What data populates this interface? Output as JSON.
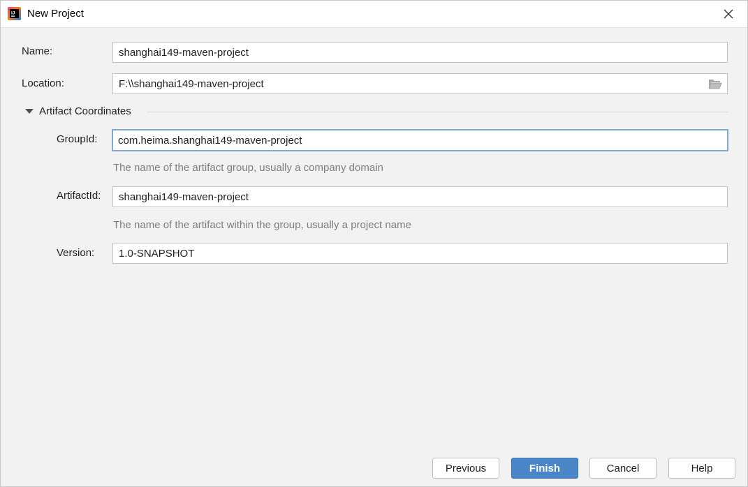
{
  "window": {
    "title": "New Project",
    "icon": "intellij-idea-icon",
    "close_icon": "close-icon"
  },
  "form": {
    "name": {
      "label": "Name:",
      "value": "shanghai149-maven-project"
    },
    "location": {
      "label": "Location:",
      "value": "F:\\\\shanghai149-maven-project",
      "browse_icon": "folder-icon"
    },
    "artifact_section": {
      "title": "Artifact Coordinates",
      "expanded": true,
      "toggle_icon": "triangle-down-icon"
    },
    "group_id": {
      "label": "GroupId:",
      "value": "com.heima.shanghai149-maven-project",
      "hint": "The name of the artifact group, usually a company domain"
    },
    "artifact_id": {
      "label": "ArtifactId:",
      "value": "shanghai149-maven-project",
      "hint": "The name of the artifact within the group, usually a project name"
    },
    "version": {
      "label": "Version:",
      "value": "1.0-SNAPSHOT"
    }
  },
  "buttons": {
    "previous": "Previous",
    "finish": "Finish",
    "cancel": "Cancel",
    "help": "Help"
  },
  "colors": {
    "accent": "#4a86c7",
    "focus_border": "#7ea6d6",
    "background": "#f2f2f2",
    "hint_text": "#7d7d7d"
  }
}
